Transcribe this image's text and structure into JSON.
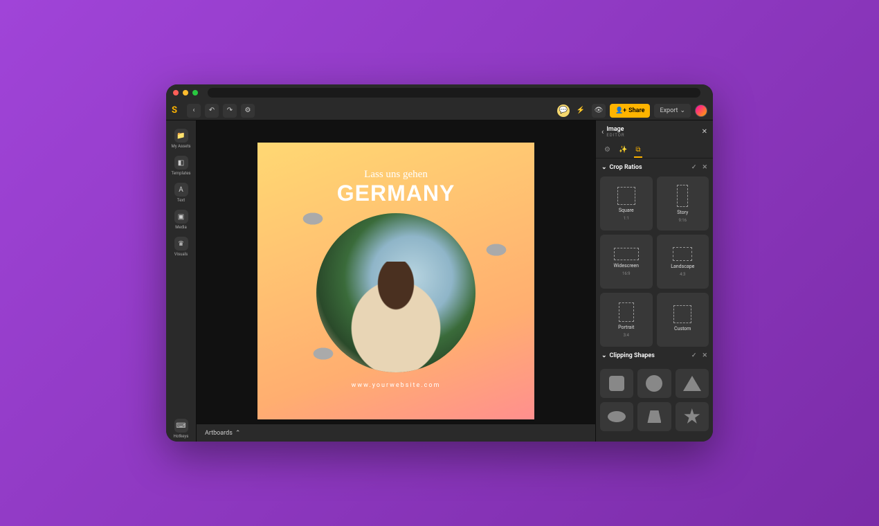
{
  "toolbar": {
    "share": "Share",
    "export": "Export"
  },
  "sidebar": {
    "items": [
      {
        "label": "My Assets"
      },
      {
        "label": "Templates"
      },
      {
        "label": "Text"
      },
      {
        "label": "Media"
      },
      {
        "label": "Visuals"
      }
    ],
    "hotkeys": "Hotkeys"
  },
  "canvas": {
    "subtitle": "Lass uns gehen",
    "title": "GERMANY",
    "url": "www.yourwebsite.com"
  },
  "bottom": {
    "artboards": "Artboards"
  },
  "panel": {
    "title": "Image",
    "subtitle": "EDITOR",
    "sections": {
      "crop": "Crop Ratios",
      "clip": "Clipping Shapes"
    },
    "ratios": [
      {
        "label": "Square",
        "sub": "1:1"
      },
      {
        "label": "Story",
        "sub": "9:16"
      },
      {
        "label": "Widescreen",
        "sub": "16:9"
      },
      {
        "label": "Landscape",
        "sub": "4:3"
      },
      {
        "label": "Portrait",
        "sub": "3:4"
      },
      {
        "label": "Custom",
        "sub": ""
      }
    ]
  }
}
